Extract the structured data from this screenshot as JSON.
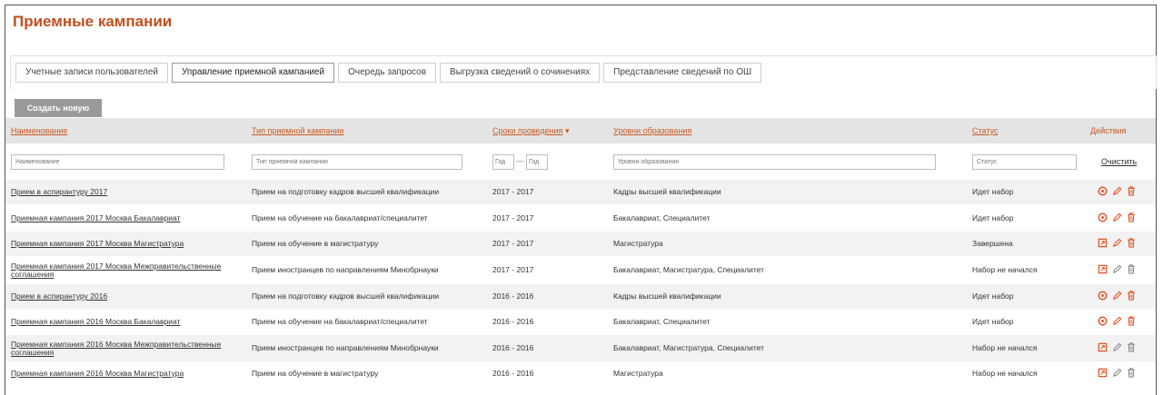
{
  "page": {
    "title": "Приемные кампании"
  },
  "tabs": [
    {
      "label": "Учетные записи пользователей",
      "active": false
    },
    {
      "label": "Управление приемной кампанией",
      "active": true
    },
    {
      "label": "Очередь запросов",
      "active": false
    },
    {
      "label": "Выгрузка сведений о сочинениях",
      "active": false
    },
    {
      "label": "Представление сведений по ОШ",
      "active": false
    }
  ],
  "toolbar": {
    "create_label": "Создать новую"
  },
  "table": {
    "columns": {
      "name": "Наименование",
      "type": "Тип приемной кампании",
      "period": "Сроки проведения",
      "levels": "Уровни образования",
      "status": "Статус",
      "actions": "Действия"
    },
    "filters": {
      "name_placeholder": "Наименование",
      "type_placeholder": "Тип приемной кампании",
      "from_placeholder": "Год",
      "to_placeholder": "Год",
      "levels_placeholder": "Уровни образования",
      "status_placeholder": "Статус",
      "clear_label": "Очистить"
    },
    "rows": [
      {
        "name": "Прием в аспирантуру 2017",
        "type": "Прием на подготовку кадров высшей квалификации",
        "period": "2017 - 2017",
        "levels": "Кадры высшей квалификации",
        "status": "Идет набор",
        "first_action": "stop-icon",
        "enabled": true
      },
      {
        "name": "Приемная кампания 2017 Москва Бакалавриат",
        "type": "Прием на обучение на бакалавриат/специалитет",
        "period": "2017 - 2017",
        "levels": "Бакалавриат, Специалитет",
        "status": "Идет набор",
        "first_action": "stop-icon",
        "enabled": true
      },
      {
        "name": "Приемная кампания 2017 Москва Магистратура",
        "type": "Прием на обучение в магистратуру",
        "period": "2017 - 2017",
        "levels": "Магистратура",
        "status": "Завершена",
        "first_action": "start-icon",
        "enabled": true
      },
      {
        "name": "Приемная кампания 2017 Москва Межправительственные соглашения",
        "type": "Прием иностранцев по направлениям Минобрнауки",
        "period": "2017 - 2017",
        "levels": "Бакалавриат, Магистратура, Специалитет",
        "status": "Набор не начался",
        "first_action": "start-icon",
        "enabled": false
      },
      {
        "name": "Прием в аспирантуру 2016",
        "type": "Прием на подготовку кадров высшей квалификации",
        "period": "2016 - 2016",
        "levels": "Кадры высшей квалификации",
        "status": "Идет набор",
        "first_action": "stop-icon",
        "enabled": true
      },
      {
        "name": "Приемная кампания 2016 Москва Бакалавриат",
        "type": "Прием на обучение на бакалавриат/специалитет",
        "period": "2016 - 2016",
        "levels": "Бакалавриат, Специалитет",
        "status": "Идет набор",
        "first_action": "stop-icon",
        "enabled": true
      },
      {
        "name": "Приемная кампания 2016 Москва Межправительственные соглашения",
        "type": "Прием иностранцев по направлениям Минобрнауки",
        "period": "2016 - 2016",
        "levels": "Бакалавриат, Магистратура, Специалитет",
        "status": "Набор не начался",
        "first_action": "start-icon",
        "enabled": false
      },
      {
        "name": "Приемная кампания 2016 Москва Магистратура",
        "type": "Прием на обучение в магистратуру",
        "period": "2016 - 2016",
        "levels": "Магистратура",
        "status": "Набор не начался",
        "first_action": "start-icon",
        "enabled": false
      }
    ]
  },
  "colors": {
    "accent": "#c0501f",
    "header_bg": "#e4e4e4",
    "row_alt": "#f2f2f2",
    "action_icon": "#e0552a",
    "disabled_icon": "#8a8a8a"
  }
}
